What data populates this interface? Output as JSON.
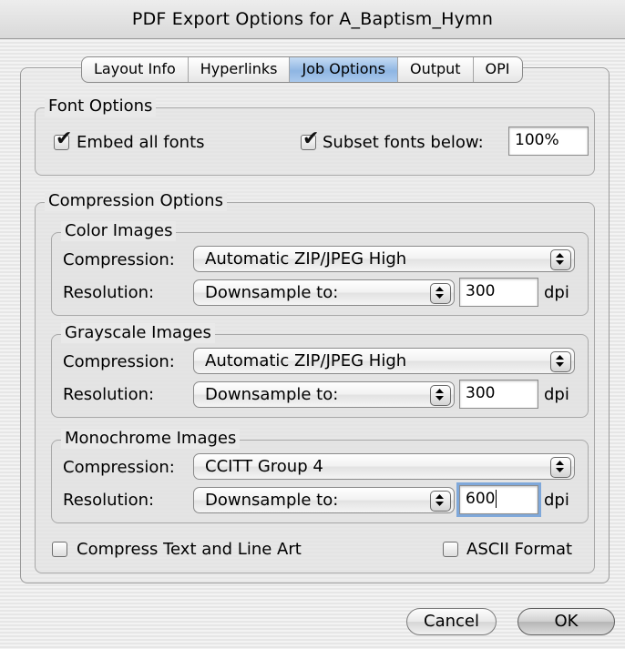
{
  "window": {
    "title": "PDF Export Options for A_Baptism_Hymn"
  },
  "tabs": [
    {
      "label": "Layout Info",
      "active": false
    },
    {
      "label": "Hyperlinks",
      "active": false
    },
    {
      "label": "Job Options",
      "active": true
    },
    {
      "label": "Output",
      "active": false
    },
    {
      "label": "OPI",
      "active": false
    }
  ],
  "font_options": {
    "title": "Font Options",
    "embed_all_fonts": {
      "label": "Embed all fonts",
      "checked": true
    },
    "subset_fonts": {
      "label": "Subset fonts below:",
      "checked": true,
      "value": "100%"
    }
  },
  "compression": {
    "title": "Compression Options",
    "color": {
      "title": "Color Images",
      "compression_label": "Compression:",
      "compression_value": "Automatic ZIP/JPEG High",
      "resolution_label": "Resolution:",
      "resolution_value": "Downsample to:",
      "dpi_value": "300",
      "dpi_unit": "dpi"
    },
    "grayscale": {
      "title": "Grayscale Images",
      "compression_label": "Compression:",
      "compression_value": "Automatic ZIP/JPEG High",
      "resolution_label": "Resolution:",
      "resolution_value": "Downsample to:",
      "dpi_value": "300",
      "dpi_unit": "dpi"
    },
    "monochrome": {
      "title": "Monochrome Images",
      "compression_label": "Compression:",
      "compression_value": "CCITT Group 4",
      "resolution_label": "Resolution:",
      "resolution_value": "Downsample to:",
      "dpi_value": "600",
      "dpi_unit": "dpi"
    },
    "compress_text": {
      "label": "Compress Text and Line Art",
      "checked": false
    },
    "ascii_format": {
      "label": "ASCII Format",
      "checked": false
    }
  },
  "buttons": {
    "cancel": "Cancel",
    "ok": "OK"
  },
  "colors": {
    "tab_active": "#8fb6e3",
    "background": "#ececec",
    "border": "#a8a8a8"
  },
  "icons": {
    "checkmark": "checkmark-icon",
    "popup_arrows": "updown-arrows-icon"
  }
}
